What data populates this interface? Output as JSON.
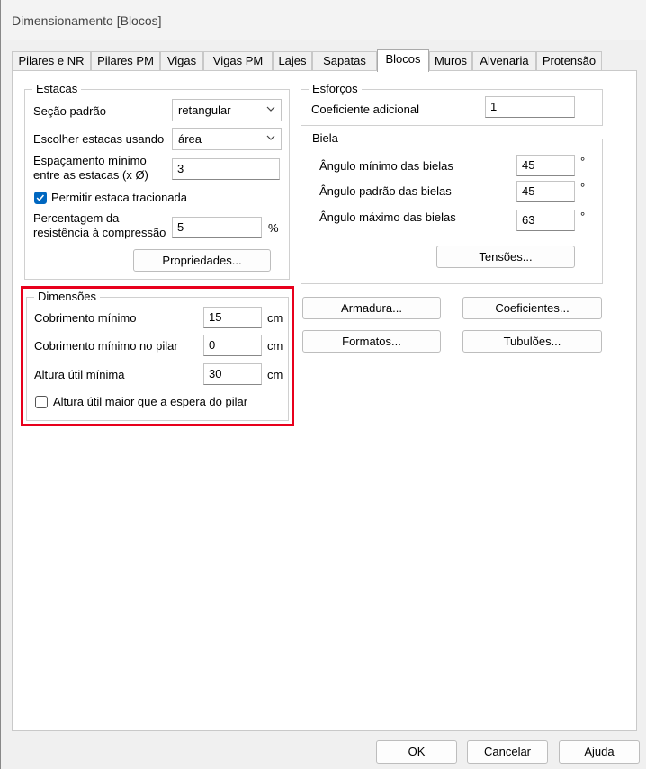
{
  "window": {
    "title": "Dimensionamento [Blocos]"
  },
  "tabs": [
    "Pilares e NR",
    "Pilares PM",
    "Vigas",
    "Vigas PM",
    "Lajes",
    "Sapatas",
    "Blocos",
    "Muros",
    "Alvenaria",
    "Protensão"
  ],
  "active_tab": "Blocos",
  "estacas": {
    "legend": "Estacas",
    "secao_label": "Seção padrão",
    "secao_value": "retangular",
    "escolher_label": "Escolher estacas usando",
    "escolher_value": "área",
    "espacamento_label_1": "Espaçamento mínimo",
    "espacamento_label_2": "entre as estacas (x Ø)",
    "espacamento_value": "3",
    "tracionada_label": "Permitir estaca tracionada",
    "tracionada_checked": true,
    "percentagem_label_1": "Percentagem da",
    "percentagem_label_2": "resistência à compressão",
    "percentagem_value": "5",
    "percentagem_unit": "%",
    "propriedades_button": "Propriedades..."
  },
  "esforcos": {
    "legend": "Esforços",
    "coef_label": "Coeficiente adicional",
    "coef_value": "1"
  },
  "biela": {
    "legend": "Biela",
    "min_label": "Ângulo mínimo das bielas",
    "min_value": "45",
    "pad_label": "Ângulo padrão das bielas",
    "pad_value": "45",
    "max_label": "Ângulo máximo das bielas",
    "max_value": "63",
    "unit": "°",
    "tensoes_button": "Tensões..."
  },
  "dimensoes": {
    "legend": "Dimensões",
    "cobrimento_label": "Cobrimento mínimo",
    "cobrimento_value": "15",
    "cobrimento_pilar_label": "Cobrimento mínimo no pilar",
    "cobrimento_pilar_value": "0",
    "altura_label": "Altura útil mínima",
    "altura_value": "30",
    "unit": "cm",
    "altura_maior_label": "Altura útil maior que a espera do pilar",
    "altura_maior_checked": false
  },
  "buttons": {
    "armadura": "Armadura...",
    "coeficientes": "Coeficientes...",
    "formatos": "Formatos...",
    "tubuloes": "Tubulões...",
    "ok": "OK",
    "cancelar": "Cancelar",
    "ajuda": "Ajuda"
  },
  "colors": {
    "checkbox_accent": "#0067c0",
    "highlight": "#e8001c"
  }
}
